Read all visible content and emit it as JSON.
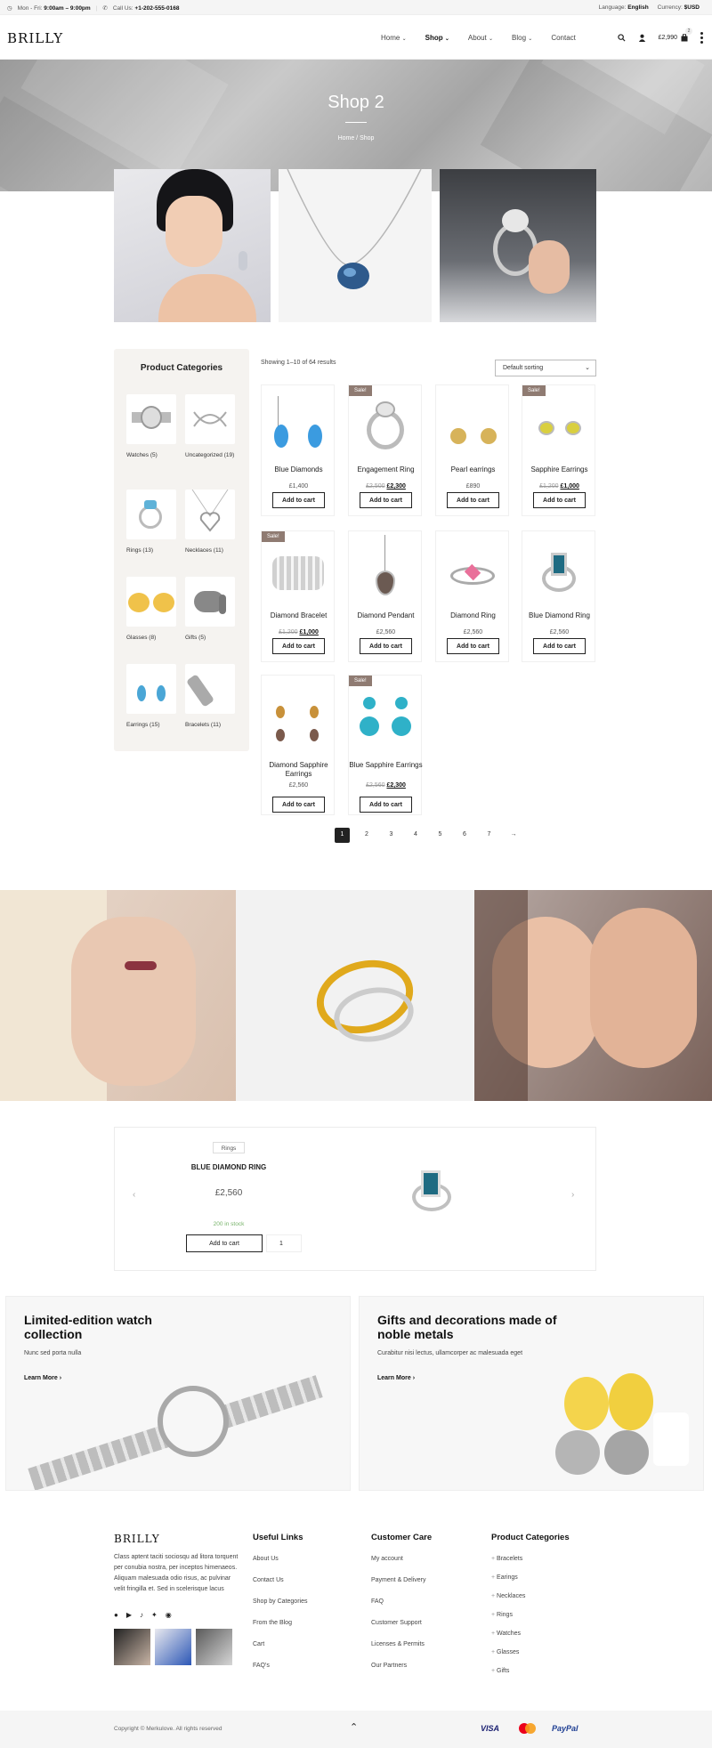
{
  "topbar": {
    "hours_prefix": "Mon - Fri: ",
    "hours": "9:00am – 9:00pm",
    "call_prefix": "Call Us: ",
    "phone": "+1-202-555-0168",
    "language_label": "Language: ",
    "language": "English",
    "currency_label": "Currency: ",
    "currency": "$USD"
  },
  "header": {
    "logo": "BRILLY",
    "nav": [
      "Home",
      "Shop",
      "About",
      "Blog",
      "Contact"
    ],
    "cart_total": "£2,990",
    "cart_count": "2"
  },
  "hero": {
    "title": "Shop 2",
    "breadcrumb": "Home / Shop"
  },
  "sidebar": {
    "title": "Product Categories",
    "categories": [
      {
        "label": "Watches (5)"
      },
      {
        "label": "Uncategorized (19)"
      },
      {
        "label": "Rings (13)"
      },
      {
        "label": "Necklaces (11)"
      },
      {
        "label": "Glasses (8)"
      },
      {
        "label": "Gifts (5)"
      },
      {
        "label": "Earrings (15)"
      },
      {
        "label": "Bracelets (11)"
      }
    ]
  },
  "shop": {
    "results": "Showing 1–10 of 64 results",
    "sort": "Default sorting",
    "add_to_cart": "Add to cart",
    "sale_badge": "Sale!",
    "products": [
      {
        "name": "Blue Diamonds",
        "price": "£1,400",
        "old": "",
        "sale": false
      },
      {
        "name": "Engagement Ring",
        "price": "£2,300",
        "old": "£2,500",
        "sale": true
      },
      {
        "name": "Pearl earrings",
        "price": "£890",
        "old": "",
        "sale": false
      },
      {
        "name": "Sapphire Earrings",
        "price": "£1,000",
        "old": "£1,200",
        "sale": true
      },
      {
        "name": "Diamond Bracelet",
        "price": "£1,000",
        "old": "£1,200",
        "sale": true
      },
      {
        "name": "Diamond Pendant",
        "price": "£2,560",
        "old": "",
        "sale": false
      },
      {
        "name": "Diamond Ring",
        "price": "£2,560",
        "old": "",
        "sale": false
      },
      {
        "name": "Blue Diamond Ring",
        "price": "£2,560",
        "old": "",
        "sale": false
      },
      {
        "name": "Diamond Sapphire Earrings",
        "price": "£2,560",
        "old": "",
        "sale": false
      },
      {
        "name": "Blue Sapphire Earrings",
        "price": "£2,300",
        "old": "£2,560",
        "sale": true
      }
    ],
    "pages": [
      "1",
      "2",
      "3",
      "4",
      "5",
      "6",
      "7",
      "→"
    ]
  },
  "featured": {
    "tag": "Rings",
    "name": "BLUE DIAMOND RING",
    "price": "£2,560",
    "stock": "200 in stock",
    "button": "Add to cart",
    "qty": "1",
    "prev": "‹",
    "next": "›"
  },
  "promos": [
    {
      "title": "Limited-edition watch collection",
      "text": "Nunc sed porta nulla",
      "link": "Learn More"
    },
    {
      "title": "Gifts and decorations made of noble metals",
      "text": "Curabitur nisi lectus, ullamcorper ac malesuada eget",
      "link": "Learn More"
    }
  ],
  "footer": {
    "logo": "BRILLY",
    "about": "Class aptent taciti sociosqu ad litora torquent per conubia nostra, per inceptos himenaeos. Aliquam malesuada odio risus, ac pulvinar velit fringilla et. Sed in scelerisque lacus",
    "useful_title": "Useful Links",
    "useful": [
      "About Us",
      "Contact Us",
      "Shop by Categories",
      "From the Blog",
      "Cart",
      "FAQ's"
    ],
    "care_title": "Customer Care",
    "care": [
      "My account",
      "Payment & Delivery",
      "FAQ",
      "Customer Support",
      "Licenses & Permits",
      "Our Partners"
    ],
    "cats_title": "Product Categories",
    "cats": [
      "Bracelets",
      "Earings",
      "Necklaces",
      "Rings",
      "Watches",
      "Glasses",
      "Gifts"
    ],
    "copyright": "Copyright © Merkulove. All rights reserved",
    "payments": [
      "VISA",
      "PayPal"
    ]
  }
}
